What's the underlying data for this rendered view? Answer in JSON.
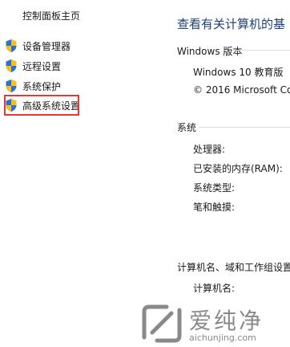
{
  "sidebar": {
    "home_link": "控制面板主页",
    "items": [
      {
        "label": "设备管理器",
        "icon": "uac-shield-icon"
      },
      {
        "label": "远程设置",
        "icon": "uac-shield-icon"
      },
      {
        "label": "系统保护",
        "icon": "uac-shield-icon"
      },
      {
        "label": "高级系统设置",
        "icon": "uac-shield-icon",
        "highlighted": true
      }
    ],
    "highlight_color": "#e53935"
  },
  "main": {
    "title": "查看有关计算机的基",
    "windows_edition": {
      "heading": "Windows 版本",
      "edition": "Windows 10 教育版",
      "copyright": "© 2016 Microsoft Co"
    },
    "system": {
      "heading": "系统",
      "rows": [
        {
          "label": "处理器:"
        },
        {
          "label": "已安装的内存(RAM):"
        },
        {
          "label": "系统类型:"
        },
        {
          "label": "笔和触摸:"
        }
      ]
    },
    "computer_name": {
      "heading": "计算机名、域和工作组设置",
      "rows": [
        {
          "label": "计算机名:"
        }
      ]
    }
  },
  "watermark": {
    "text": "爱纯净",
    "url": "aichunjing.com"
  },
  "colors": {
    "title": "#1e3f7a",
    "shield_blue": "#2f6fd1",
    "shield_yellow": "#f2c21b"
  }
}
